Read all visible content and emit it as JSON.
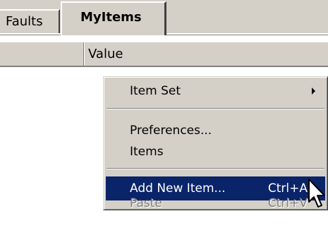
{
  "tabs": {
    "items": [
      {
        "label": "Faults",
        "selected": false
      },
      {
        "label": "MyItems",
        "selected": true
      }
    ]
  },
  "table": {
    "columns": [
      "",
      "Value"
    ]
  },
  "context_menu": {
    "items": [
      {
        "label": "Item Set",
        "submenu": true
      },
      {
        "label": "Preferences..."
      },
      {
        "label": "Items"
      },
      {
        "label": "Add New Item...",
        "shortcut": "Ctrl+A",
        "highlighted": true
      },
      {
        "label": "Paste",
        "shortcut": "Ctrl+V",
        "disabled": true
      }
    ]
  },
  "colors": {
    "face": "#d4d0c8",
    "highlight": "#0a246a",
    "highlight_text": "#ffffff",
    "disabled_text": "#808080"
  },
  "icons": {
    "submenu_arrow": "triangle-right-icon",
    "cursor": "arrow-cursor-icon"
  }
}
